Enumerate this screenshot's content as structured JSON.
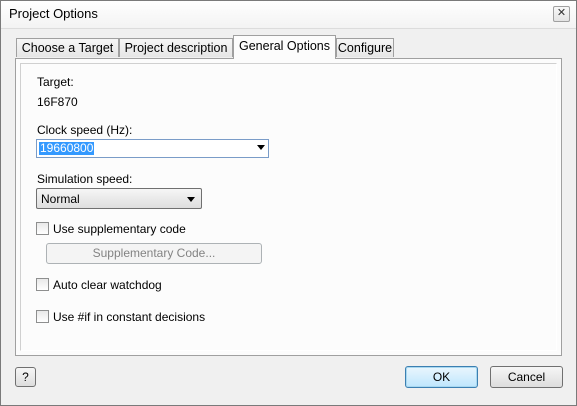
{
  "window": {
    "title": "Project Options",
    "close_glyph": "✕"
  },
  "tabs": [
    {
      "label": "Choose a Target",
      "active": false
    },
    {
      "label": "Project description",
      "active": false
    },
    {
      "label": "General Options",
      "active": true
    },
    {
      "label": "Configure",
      "active": false
    }
  ],
  "general": {
    "target_label": "Target:",
    "target_value": "16F870",
    "clock_label": "Clock speed (Hz):",
    "clock_value": "19660800",
    "sim_label": "Simulation speed:",
    "sim_value": "Normal",
    "use_supp_label": "Use supplementary code",
    "use_supp_checked": false,
    "supp_button_label": "Supplementary Code...",
    "auto_clear_label": "Auto clear watchdog",
    "auto_clear_checked": false,
    "use_if_label": "Use #if in constant decisions",
    "use_if_checked": false
  },
  "footer": {
    "help_label": "?",
    "ok_label": "OK",
    "cancel_label": "Cancel"
  }
}
